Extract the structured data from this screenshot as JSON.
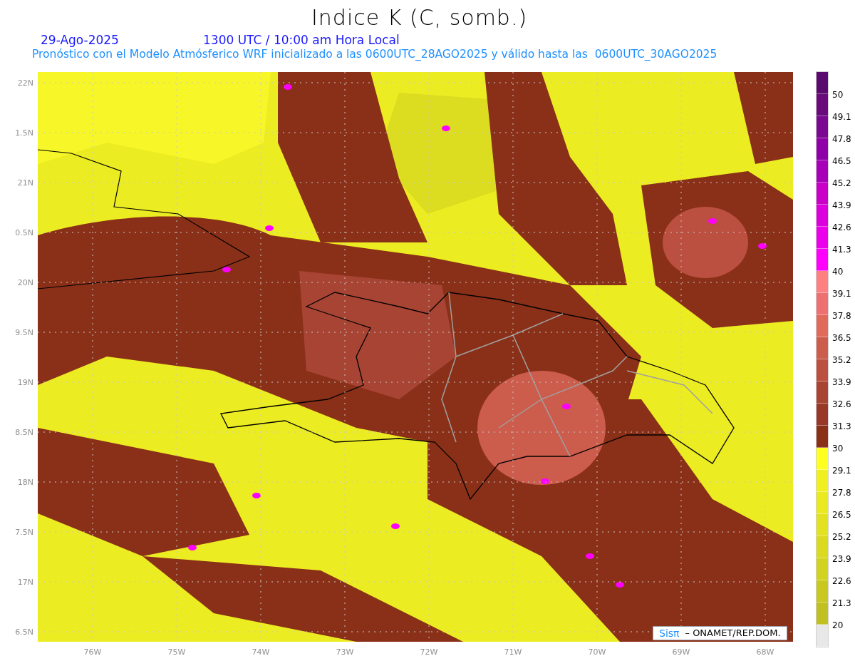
{
  "title": "Indice K (C, somb.)",
  "date": "29-Ago-2025",
  "time": "1300 UTC / 10:00 am Hora Local",
  "subtitle": "Pronóstico con el Modelo Atmósferico WRF inicializado a las 0600UTC_28AGO2025 y válido hasta las  0600UTC_30AGO2025",
  "map": {
    "y_labels": [
      "22N",
      "1.5N",
      "21N",
      "0.5N",
      "20N",
      "9.5N",
      "19N",
      "8.5N",
      "18N",
      "7.5N",
      "17N",
      "6.5N"
    ],
    "x_labels": [
      "76W",
      "75W",
      "74W",
      "73W",
      "72W",
      "71W",
      "70W",
      "69W",
      "68W"
    ],
    "credit": {
      "brand": "Sisπ",
      "text": "– ONAMET/REP.DOM."
    }
  },
  "legend": [
    {
      "color": "#5a0a6e",
      "label": "50"
    },
    {
      "color": "#6a0a7c",
      "label": "49.1"
    },
    {
      "color": "#7a0890",
      "label": "47.8"
    },
    {
      "color": "#9000a8",
      "label": "46.5"
    },
    {
      "color": "#a800b8",
      "label": "45.2"
    },
    {
      "color": "#c800c8",
      "label": "43.9"
    },
    {
      "color": "#dc00dc",
      "label": "42.6"
    },
    {
      "color": "#ec00ec",
      "label": "41.3"
    },
    {
      "color": "#ff00ff",
      "label": "40"
    },
    {
      "color": "#ff8080",
      "label": "39.1"
    },
    {
      "color": "#ee7070",
      "label": "37.8"
    },
    {
      "color": "#e06a5c",
      "label": "36.5"
    },
    {
      "color": "#cc5c4c",
      "label": "35.2"
    },
    {
      "color": "#bb5040",
      "label": "33.9"
    },
    {
      "color": "#a84434",
      "label": "32.6"
    },
    {
      "color": "#983828",
      "label": "31.3"
    },
    {
      "color": "#8a3018",
      "label": "30"
    },
    {
      "color": "#ffff20",
      "label": "29.1"
    },
    {
      "color": "#f0f020",
      "label": "27.8"
    },
    {
      "color": "#eaea20",
      "label": "26.5"
    },
    {
      "color": "#e2e220",
      "label": "25.2"
    },
    {
      "color": "#dada20",
      "label": "23.9"
    },
    {
      "color": "#d2d220",
      "label": "22.6"
    },
    {
      "color": "#c8c820",
      "label": "21.3"
    },
    {
      "color": "#c0c020",
      "label": "20"
    },
    {
      "color": "#e8e8e8"
    }
  ]
}
